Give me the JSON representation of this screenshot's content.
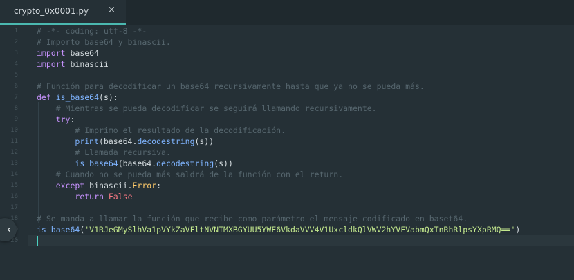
{
  "tab": {
    "title": "crypto_0x0001.py",
    "close_glyph": "×"
  },
  "editor": {
    "current_line": 19,
    "lines": [
      {
        "n": "1",
        "tokens": [
          {
            "t": "com",
            "v": "# -*- coding: utf-8 -*-"
          }
        ]
      },
      {
        "n": "2",
        "tokens": [
          {
            "t": "com",
            "v": "# Importo base64 y binascii."
          }
        ]
      },
      {
        "n": "3",
        "tokens": [
          {
            "t": "kw",
            "v": "import"
          },
          {
            "t": "txt",
            "v": " base64"
          }
        ]
      },
      {
        "n": "4",
        "tokens": [
          {
            "t": "kw",
            "v": "import"
          },
          {
            "t": "txt",
            "v": " binascii"
          }
        ]
      },
      {
        "n": "5",
        "tokens": []
      },
      {
        "n": "6",
        "tokens": [
          {
            "t": "com",
            "v": "# Función para decodificar un base64 recursivamente hasta que ya no se pueda más."
          }
        ]
      },
      {
        "n": "7",
        "tokens": [
          {
            "t": "kw",
            "v": "def"
          },
          {
            "t": "txt",
            "v": " "
          },
          {
            "t": "fn",
            "v": "is_base64"
          },
          {
            "t": "txt",
            "v": "(s):"
          }
        ]
      },
      {
        "n": "8",
        "tokens": [
          {
            "t": "txt",
            "v": "    "
          },
          {
            "t": "com",
            "v": "# Mientras se pueda decodificar se seguirá llamando recursivamente."
          }
        ]
      },
      {
        "n": "9",
        "tokens": [
          {
            "t": "txt",
            "v": "    "
          },
          {
            "t": "kw",
            "v": "try"
          },
          {
            "t": "txt",
            "v": ":"
          }
        ]
      },
      {
        "n": "10",
        "tokens": [
          {
            "t": "txt",
            "v": "        "
          },
          {
            "t": "com",
            "v": "# Imprimo el resultado de la decodificación."
          }
        ]
      },
      {
        "n": "11",
        "tokens": [
          {
            "t": "txt",
            "v": "        "
          },
          {
            "t": "fn",
            "v": "print"
          },
          {
            "t": "txt",
            "v": "(base64."
          },
          {
            "t": "fn",
            "v": "decodestring"
          },
          {
            "t": "txt",
            "v": "(s))"
          }
        ]
      },
      {
        "n": "12",
        "tokens": [
          {
            "t": "txt",
            "v": "        "
          },
          {
            "t": "com",
            "v": "# Llamada recursiva."
          }
        ]
      },
      {
        "n": "13",
        "tokens": [
          {
            "t": "txt",
            "v": "        "
          },
          {
            "t": "fn",
            "v": "is_base64"
          },
          {
            "t": "txt",
            "v": "(base64."
          },
          {
            "t": "fn",
            "v": "decodestring"
          },
          {
            "t": "txt",
            "v": "(s))"
          }
        ]
      },
      {
        "n": "14",
        "tokens": [
          {
            "t": "txt",
            "v": "    "
          },
          {
            "t": "com",
            "v": "# Cuando no se pueda más saldrá de la función con el return."
          }
        ]
      },
      {
        "n": "15",
        "tokens": [
          {
            "t": "txt",
            "v": "    "
          },
          {
            "t": "kw",
            "v": "except"
          },
          {
            "t": "txt",
            "v": " binascii."
          },
          {
            "t": "cls",
            "v": "Error"
          },
          {
            "t": "txt",
            "v": ":"
          }
        ]
      },
      {
        "n": "16",
        "tokens": [
          {
            "t": "txt",
            "v": "        "
          },
          {
            "t": "kw",
            "v": "return"
          },
          {
            "t": "txt",
            "v": " "
          },
          {
            "t": "bool",
            "v": "False"
          }
        ]
      },
      {
        "n": "17",
        "tokens": []
      },
      {
        "n": "18",
        "tokens": [
          {
            "t": "com",
            "v": "# Se manda a llamar la función que recibe como parámetro el mensaje codificado en baset64."
          }
        ]
      },
      {
        "n": "19",
        "tokens": [
          {
            "t": "fn",
            "v": "is_base64"
          },
          {
            "t": "txt",
            "v": "("
          },
          {
            "t": "str",
            "v": "'V1RJeGMySlhVa1pVYkZaVFltNVNTMXBGYUU5YWF6VkdaVVV4V1UxcldkQlVWV2hYVFVabmQxTnRhRlpsYXpRMQ=='"
          },
          {
            "t": "txt",
            "v": ")"
          }
        ]
      },
      {
        "n": "20",
        "tokens": []
      }
    ]
  }
}
